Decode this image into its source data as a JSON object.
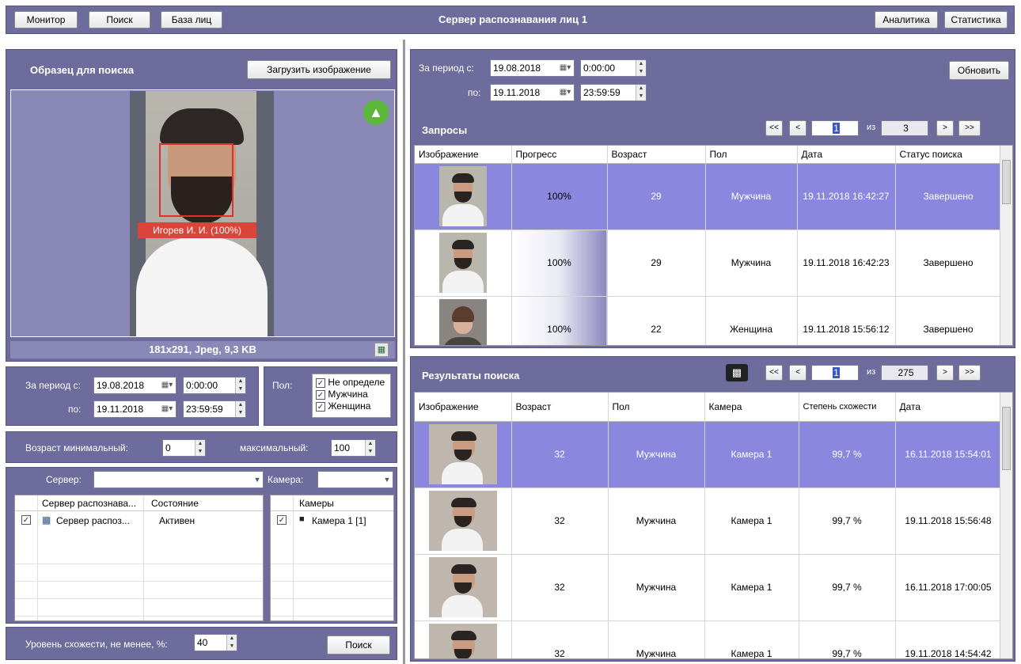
{
  "topbar": {
    "monitor": "Монитор",
    "search": "Поиск",
    "face_base": "База лиц",
    "title": "Сервер распознавания лиц 1",
    "analytics": "Аналитика",
    "statistics": "Статистика"
  },
  "sample": {
    "title": "Образец для поиска",
    "load_button": "Загрузить изображение",
    "face_label": "Игорев И. И. (100%)",
    "image_info": "181x291, Jpeg, 9,3 KB"
  },
  "filter": {
    "period_from_label": "За период с:",
    "date_from": "19.08.2018",
    "time_from": "0:00:00",
    "period_to_label": "по:",
    "date_to": "19.11.2018",
    "time_to": "23:59:59",
    "gender_label": "Пол:",
    "gender_options": [
      "Не определе",
      "Мужчина",
      "Женщина"
    ],
    "age_min_label": "Возраст минимальный:",
    "age_min": "0",
    "age_max_label": "максимальный:",
    "age_max": "100",
    "server_label": "Сервер:",
    "camera_label": "Камера:",
    "server_table": {
      "headers": [
        "Сервер распознава...",
        "Состояние"
      ],
      "rows": [
        {
          "name": "Сервер распоз...",
          "state": "Активен"
        }
      ]
    },
    "camera_table": {
      "header": "Камеры",
      "rows": [
        "Камера 1 [1]"
      ]
    },
    "similarity_label": "Уровень схожести, не менее, %:",
    "similarity": "40",
    "search_button": "Поиск"
  },
  "queries": {
    "period_from_label": "За период с:",
    "date_from": "19.08.2018",
    "time_from": "0:00:00",
    "period_to_label": "по:",
    "date_to": "19.11.2018",
    "time_to": "23:59:59",
    "refresh": "Обновить",
    "title": "Запросы",
    "pager": {
      "first": "<<",
      "prev": "<",
      "page": "1",
      "of": "из",
      "total": "3",
      "next": ">",
      "last": ">>"
    },
    "headers": [
      "Изображение",
      "Прогресс",
      "Возраст",
      "Пол",
      "Дата",
      "Статус поиска"
    ],
    "rows": [
      {
        "progress": "100%",
        "age": "29",
        "gender": "Мужчина",
        "date": "19.11.2018 16:42:27",
        "status": "Завершено"
      },
      {
        "progress": "100%",
        "age": "29",
        "gender": "Мужчина",
        "date": "19.11.2018 16:42:23",
        "status": "Завершено"
      },
      {
        "progress": "100%",
        "age": "22",
        "gender": "Женщина",
        "date": "19.11.2018 15:56:12",
        "status": "Завершено"
      }
    ]
  },
  "results": {
    "title": "Результаты поиска",
    "pager": {
      "first": "<<",
      "prev": "<",
      "page": "1",
      "of": "из",
      "total": "275",
      "next": ">",
      "last": ">>"
    },
    "headers": [
      "Изображение",
      "Возраст",
      "Пол",
      "Камера",
      "Степень схожести",
      "Дата"
    ],
    "rows": [
      {
        "age": "32",
        "gender": "Мужчина",
        "camera": "Камера 1",
        "similarity": "99,7 %",
        "date": "16.11.2018 15:54:01"
      },
      {
        "age": "32",
        "gender": "Мужчина",
        "camera": "Камера 1",
        "similarity": "99,7 %",
        "date": "19.11.2018 15:56:48"
      },
      {
        "age": "32",
        "gender": "Мужчина",
        "camera": "Камера 1",
        "similarity": "99,7 %",
        "date": "16.11.2018 17:00:05"
      },
      {
        "age": "32",
        "gender": "Мужчина",
        "camera": "Камера 1",
        "similarity": "99,7 %",
        "date": "19.11.2018 14:54:42"
      }
    ]
  },
  "colors": {
    "panel": "#6e6c9c",
    "selected_row": "#8b87de",
    "like_badge": "#5cb83b",
    "face_label": "#d9453a"
  }
}
